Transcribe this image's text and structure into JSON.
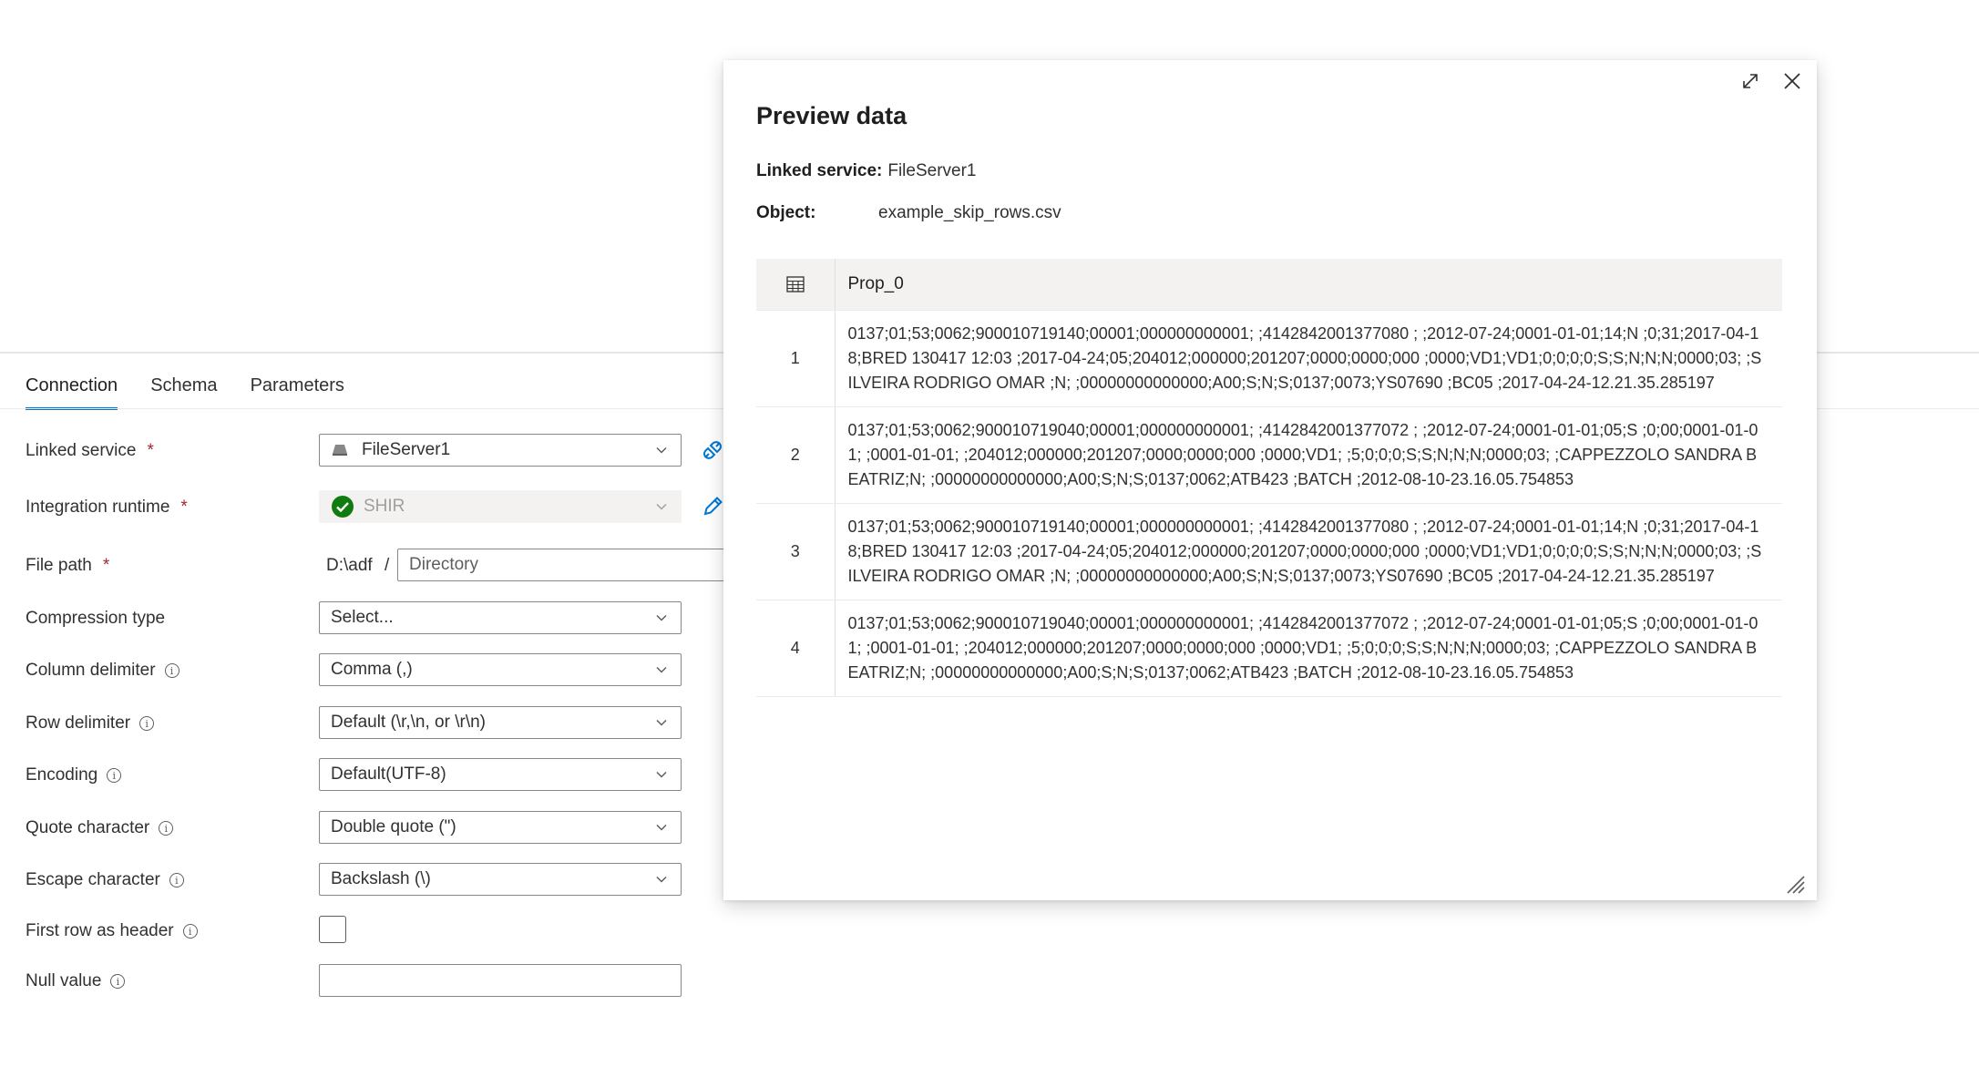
{
  "tabs": [
    {
      "label": "Connection",
      "active": true
    },
    {
      "label": "Schema",
      "active": false
    },
    {
      "label": "Parameters",
      "active": false
    }
  ],
  "form": {
    "linked_service": {
      "label": "Linked service",
      "required": true,
      "value": "FileServer1",
      "icon": "server-icon",
      "side_icon": "test-connection-icon"
    },
    "integration_runtime": {
      "label": "Integration runtime",
      "required": true,
      "value": "SHIR",
      "status_icon": "check-circle-icon",
      "status_color": "#107c10",
      "side_icon": "edit-pencil-icon"
    },
    "file_path": {
      "label": "File path",
      "required": true,
      "prefix": "D:\\adf",
      "separator": "/",
      "directory_placeholder": "Directory"
    },
    "compression_type": {
      "label": "Compression type",
      "value": "Select..."
    },
    "column_delimiter": {
      "label": "Column delimiter",
      "value": "Comma (,)"
    },
    "row_delimiter": {
      "label": "Row delimiter",
      "value": "Default (\\r,\\n, or \\r\\n)"
    },
    "encoding": {
      "label": "Encoding",
      "value": "Default(UTF-8)"
    },
    "quote_character": {
      "label": "Quote character",
      "value": "Double quote (\")"
    },
    "escape_character": {
      "label": "Escape character",
      "value": "Backslash (\\)"
    },
    "first_row_header": {
      "label": "First row as header",
      "checked": false
    },
    "null_value": {
      "label": "Null value",
      "value": ""
    },
    "info_glyph": "i",
    "required_mark": "*"
  },
  "modal": {
    "title": "Preview data",
    "linked_service_key": "Linked service:",
    "linked_service_value": "FileServer1",
    "object_key": "Object:",
    "object_value": "example_skip_rows.csv",
    "table": {
      "header_icon": "table-grid-icon",
      "column": "Prop_0",
      "rows": [
        {
          "index": "1",
          "value": "0137;01;53;0062;900010719140;00001;000000000001; ;4142842001377080 ; ;2012-07-24;0001-01-01;14;N ;0;31;2017-04-18;BRED 130417 12:03 ;2017-04-24;05;204012;000000;201207;0000;0000;000 ;0000;VD1;VD1;0;0;0;0;S;S;N;N;N;0000;03; ;SILVEIRA RODRIGO OMAR ;N; ;00000000000000;A00;S;N;S;0137;0073;YS07690 ;BC05 ;2017-04-24-12.21.35.285197"
        },
        {
          "index": "2",
          "value": "0137;01;53;0062;900010719040;00001;000000000001; ;4142842001377072 ; ;2012-07-24;0001-01-01;05;S ;0;00;0001-01-01; ;0001-01-01; ;204012;000000;201207;0000;0000;000 ;0000;VD1; ;5;0;0;0;S;S;N;N;N;0000;03; ;CAPPEZZOLO SANDRA BEATRIZ;N; ;00000000000000;A00;S;N;S;0137;0062;ATB423 ;BATCH ;2012-08-10-23.16.05.754853"
        },
        {
          "index": "3",
          "value": "0137;01;53;0062;900010719140;00001;000000000001; ;4142842001377080 ; ;2012-07-24;0001-01-01;14;N ;0;31;2017-04-18;BRED 130417 12:03 ;2017-04-24;05;204012;000000;201207;0000;0000;000 ;0000;VD1;VD1;0;0;0;0;S;S;N;N;N;0000;03; ;SILVEIRA RODRIGO OMAR ;N; ;00000000000000;A00;S;N;S;0137;0073;YS07690 ;BC05 ;2017-04-24-12.21.35.285197"
        },
        {
          "index": "4",
          "value": "0137;01;53;0062;900010719040;00001;000000000001; ;4142842001377072 ; ;2012-07-24;0001-01-01;05;S ;0;00;0001-01-01; ;0001-01-01; ;204012;000000;201207;0000;0000;000 ;0000;VD1; ;5;0;0;0;S;S;N;N;N;0000;03; ;CAPPEZZOLO SANDRA BEATRIZ;N; ;00000000000000;A00;S;N;S;0137;0062;ATB423 ;BATCH ;2012-08-10-23.16.05.754853"
        }
      ]
    },
    "icons": {
      "expand": "expand-icon",
      "close": "close-icon",
      "resize": "resize-grip-icon"
    }
  },
  "colors": {
    "accent": "#0078d4",
    "success": "#107c10",
    "required": "#a4262c"
  }
}
